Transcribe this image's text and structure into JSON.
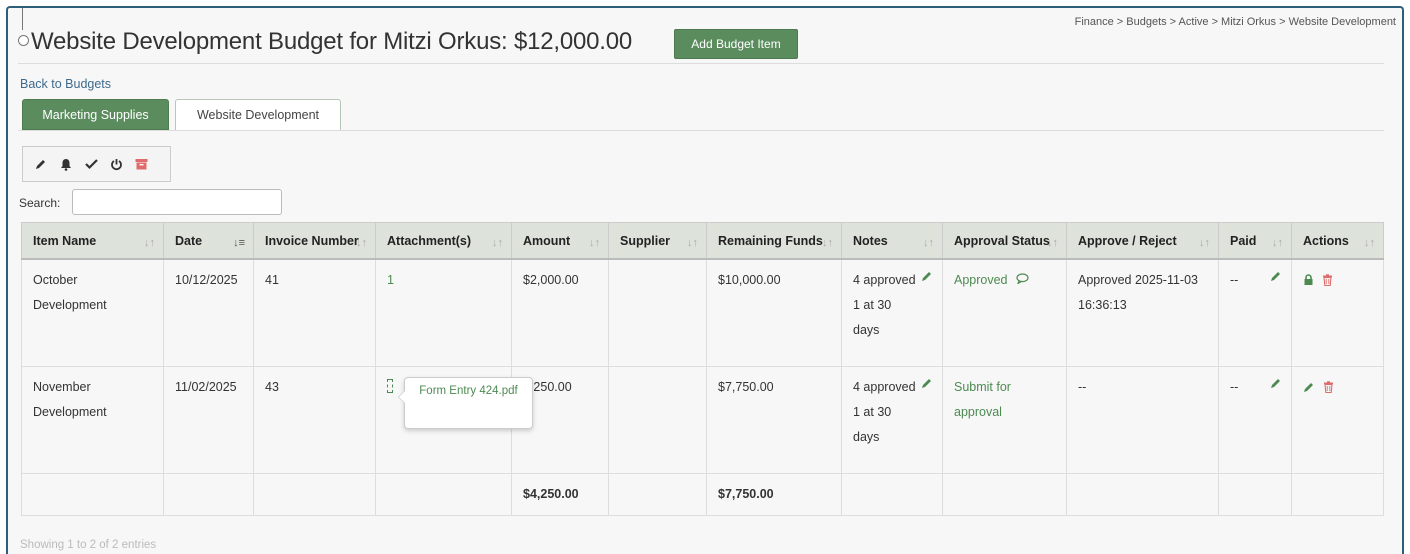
{
  "header": {
    "title": "Website Development Budget for Mitzi Orkus: $12,000.00",
    "add_button": "Add Budget Item",
    "breadcrumb": "Finance > Budgets > Active > Mitzi Orkus > Website Development"
  },
  "back_link": "Back to Budgets",
  "tabs": [
    {
      "label": "Marketing Supplies",
      "active": true
    },
    {
      "label": "Website Development",
      "active": false
    }
  ],
  "toolbar_icons": [
    "pencil-icon",
    "bell-icon",
    "check-icon",
    "power-icon",
    "archive-icon"
  ],
  "search": {
    "label": "Search:",
    "value": ""
  },
  "table": {
    "columns": [
      "Item Name",
      "Date",
      "Invoice Number",
      "Attachment(s)",
      "Amount",
      "Supplier",
      "Remaining Funds",
      "Notes",
      "Approval Status",
      "Approve / Reject",
      "Paid",
      "Actions"
    ],
    "rows": [
      {
        "item_name": "October Development",
        "date": "10/12/2025",
        "invoice": "41",
        "attachments": "1",
        "amount": "$2,000.00",
        "supplier": "",
        "remaining": "$10,000.00",
        "notes": "4 approved 1 at 30 days",
        "approval_status": "Approved",
        "approve_reject": "Approved 2025-11-03 16:36:13",
        "paid": "--"
      },
      {
        "item_name": "November Development",
        "date": "11/02/2025",
        "invoice": "43",
        "attachments": "",
        "amount": "2,250.00",
        "supplier": "",
        "remaining": "$7,750.00",
        "notes": "4 approved 1 at 30 days",
        "approval_status": "Submit for approval",
        "approve_reject": "--",
        "paid": "--"
      }
    ],
    "totals": {
      "amount": "$4,250.00",
      "remaining": "$7,750.00"
    }
  },
  "popover": {
    "filename": "Form Entry 424.pdf"
  },
  "footer": "Showing 1 to 2 of 2 entries",
  "colors": {
    "accent_green": "#5b8c5e",
    "frame_border": "#2e5f7a",
    "link_blue": "#3d6a8c",
    "delete_red": "#e06b6b"
  }
}
